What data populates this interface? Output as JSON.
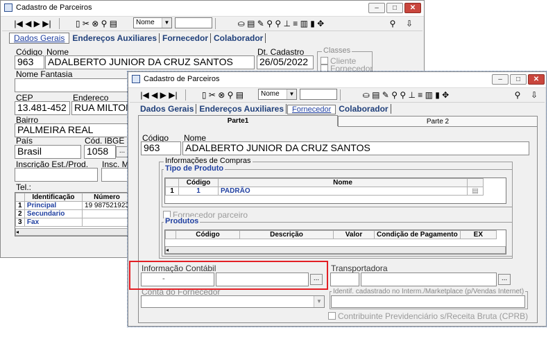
{
  "back_window": {
    "title": "Cadastro de Parceiros",
    "toolbar": {
      "nav_icons": "|◀ ◀ ▶ ▶|",
      "icons": "▯ ✂ ⊗ ⚲ ▤",
      "combo_value": "Nome",
      "right_icons": "⛀ ▤ ✎ ⚲ ⚲ ⊥ ≡ ▥ ▮ ✥",
      "user_icon": "⚲",
      "exit_icon": "⇩"
    },
    "tabs": [
      "Dados Gerais",
      "Endereços Auxiliares",
      "Fornecedor",
      "Colaborador"
    ],
    "labels": {
      "codigo": "Código",
      "nome": "Nome",
      "dt_cadastro": "Dt. Cadastro",
      "classes": "Classes",
      "nome_fantasia": "Nome Fantasia",
      "cep": "CEP",
      "endereco": "Endereco",
      "bairro": "Bairro",
      "pais": "País",
      "cod_ibge": "Cód. IBGE",
      "insc_est": "Inscrição Est./Prod.",
      "insc_m": "Insc. M",
      "tel": "Tel.:"
    },
    "values": {
      "codigo": "963",
      "nome": "ADALBERTO JUNIOR DA CRUZ SANTOS",
      "dt_cadastro": "26/05/2022",
      "cep": "13.481-452",
      "endereco": "RUA MILTON",
      "bairro": "PALMEIRA REAL",
      "pais": "Brasil",
      "cod_ibge": "1058",
      "ibge_btn": "..."
    },
    "classes": {
      "cliente": "Cliente",
      "fornecedor": "Fornecedor"
    },
    "tel_grid": {
      "headers": [
        "Identificação",
        "Número"
      ],
      "rows": [
        [
          "1",
          "Principal",
          "19 987521923"
        ],
        [
          "2",
          "Secundario",
          ""
        ],
        [
          "3",
          "Fax",
          ""
        ]
      ]
    }
  },
  "front_window": {
    "title": "Cadastro de Parceiros",
    "toolbar": {
      "nav_icons": "|◀ ◀ ▶ ▶|",
      "icons": "▯ ✂ ⊗ ⚲ ▤",
      "combo_value": "Nome",
      "right_icons": "⛀ ▤ ✎ ⚲ ⚲ ⊥ ≡ ▥ ▮ ✥",
      "user_icon": "⚲",
      "exit_icon": "⇩"
    },
    "tabs": [
      "Dados Gerais",
      "Endereços Auxiliares",
      "Fornecedor",
      "Colaborador"
    ],
    "sub_tabs": [
      "Parte1",
      "Parte 2"
    ],
    "labels": {
      "codigo": "Código",
      "nome": "Nome",
      "info_compras": "Informações de Compras",
      "tipo_produto": "Tipo de Produto",
      "fornecedor_parceiro": "Fornecedor parceiro",
      "produtos": "Produtos",
      "info_contabil": "Informação Contábil",
      "transportadora": "Transportadora",
      "conta_fornecedor": "Conta do Fornecedor",
      "identif": "Identif. cadastrado no Interm./Marketplace (p/Vendas Internet)",
      "contribuinte": "Contribuinte Previdenciário s/Receita Bruta (CPRB)"
    },
    "values": {
      "codigo": "963",
      "nome": "ADALBERTO JUNIOR DA CRUZ SANTOS",
      "contabil_code": "-",
      "btn": "..."
    },
    "tipo_grid": {
      "headers": [
        "Código",
        "Nome"
      ],
      "rows": [
        [
          "1",
          "1",
          "PADRÃO"
        ]
      ]
    },
    "produtos_grid": {
      "headers": [
        "Código",
        "Descrição",
        "Valor",
        "Condição de Pagamento",
        "EX"
      ]
    }
  },
  "colors": {
    "highlight": "#e31e24",
    "label_blue": "#1f3fa0"
  }
}
